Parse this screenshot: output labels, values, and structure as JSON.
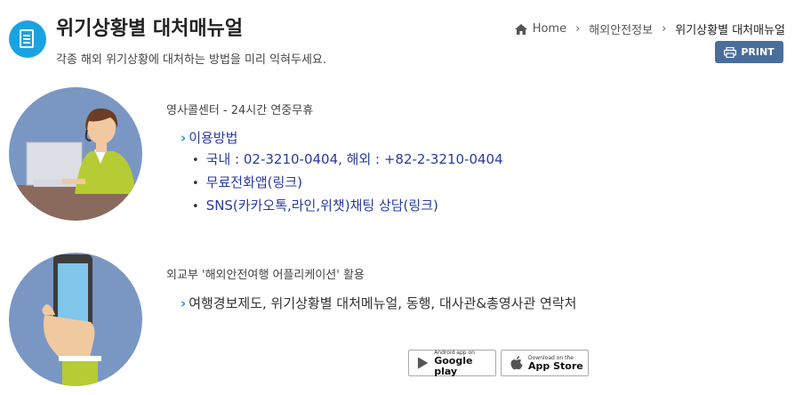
{
  "header": {
    "title": "위기상황별 대처매뉴얼",
    "subtitle": "각종 해외 위기상황에 대처하는 방법을 미리 익혀두세요.",
    "icon": "document-icon"
  },
  "breadcrumb": {
    "home": "Home",
    "items": [
      "해외안전정보",
      "위기상황별 대처매뉴얼"
    ]
  },
  "print_button": {
    "label": "PRINT",
    "icon": "printer-icon"
  },
  "sections": [
    {
      "title": "영사콜센터  -  24시간 연중무휴",
      "lead": "이용방법",
      "bullets": [
        "국내 : 02-3210-0404, 해외 : +82-2-3210-0404",
        "무료전화앱(링크)",
        "SNS(카카오톡,라인,위챗)채팅 상담(링크)"
      ],
      "illustration": "call-center-operator-icon"
    },
    {
      "title": "외교부 '해외안전여행 어플리케이션' 활용",
      "lead": "여행경보제도, 위기상황별 대처메뉴얼, 동행, 대사관&총영사관 연락처",
      "illustration": "hand-holding-phone-icon"
    }
  ],
  "stores": [
    {
      "small": "Android app on",
      "large": "Google play",
      "icon": "google-play-icon"
    },
    {
      "small": "Download on the",
      "large": "App Store",
      "icon": "apple-icon"
    }
  ],
  "colors": {
    "accent": "#1aa3e0",
    "print_bg": "#4a6e9c",
    "link": "#2a3aa0",
    "circle": "#7a97c4"
  }
}
